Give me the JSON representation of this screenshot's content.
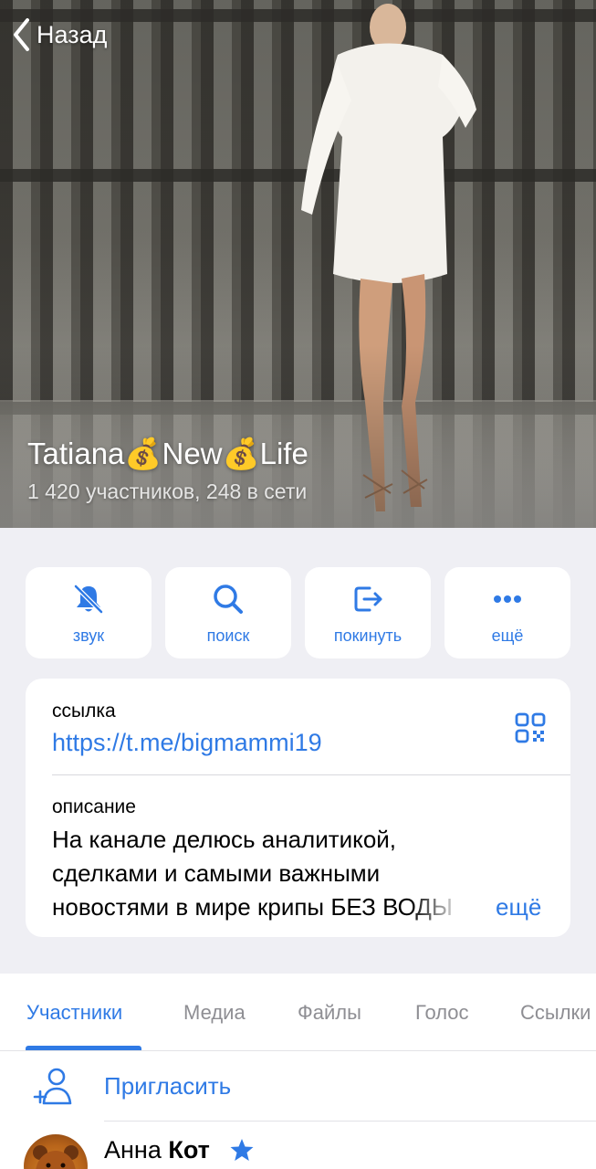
{
  "nav": {
    "back_label": "Назад"
  },
  "channel": {
    "title": "Tatiana💰New💰Life",
    "subtitle": "1 420 участников, 248 в сети"
  },
  "actions": [
    {
      "label": "звук",
      "icon": "bell-slash-icon"
    },
    {
      "label": "поиск",
      "icon": "search-icon"
    },
    {
      "label": "покинуть",
      "icon": "leave-icon"
    },
    {
      "label": "ещё",
      "icon": "more-dots-icon"
    }
  ],
  "info": {
    "link_label": "ссылка",
    "link": "https://t.me/bigmammi19",
    "description_label": "описание",
    "description": "На канале делюсь аналитикой, сделками и самыми важными новостями в мире крипы БЕЗ ВОДЫ",
    "more_label": "ещё",
    "qr_icon": "qr-code-icon"
  },
  "tabs": [
    {
      "label": "Участники",
      "active": true
    },
    {
      "label": "Медиа"
    },
    {
      "label": "Файлы"
    },
    {
      "label": "Голос"
    },
    {
      "label": "Ссылки"
    }
  ],
  "invite": {
    "label": "Пригласить",
    "icon": "add-user-icon"
  },
  "members": [
    {
      "first_name": "Анна",
      "last_name": "Кот",
      "badge": "star-icon"
    }
  ],
  "colors": {
    "accent": "#2f7ae5",
    "background": "#efeff4",
    "card": "#ffffff",
    "secondary_text": "#8e8e93"
  }
}
